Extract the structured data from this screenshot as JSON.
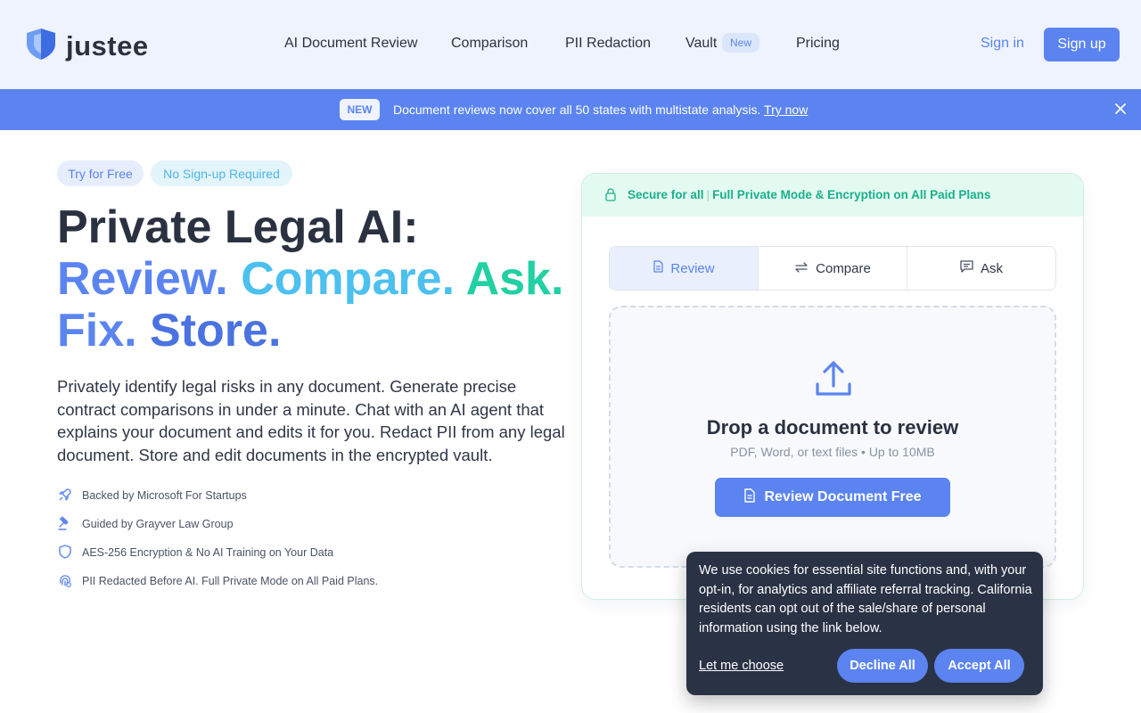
{
  "header": {
    "logo_text": "justee",
    "nav": [
      {
        "label": "AI Document Review"
      },
      {
        "label": "Comparison"
      },
      {
        "label": "PII Redaction"
      },
      {
        "label": "Vault",
        "badge": "New"
      },
      {
        "label": "Pricing"
      }
    ],
    "sign_in": "Sign in",
    "sign_up": "Sign up"
  },
  "banner": {
    "badge": "NEW",
    "text": "Document reviews now cover all 50 states with multistate analysis.",
    "link": "Try now",
    "close_icon": "close-icon"
  },
  "hero": {
    "chips": [
      "Try for Free",
      "No Sign-up Required"
    ],
    "headline_1": "Private Legal AI:",
    "headline_2": [
      "Review.",
      "Compare.",
      "Ask."
    ],
    "headline_3": [
      "Fix.",
      "Store."
    ],
    "description": "Privately identify legal risks in any document. Generate precise contract comparisons in under a minute. Chat with an AI agent that explains your document and edits it for you. Redact PII from any legal document. Store and edit documents in the encrypted vault.",
    "features": [
      {
        "icon": "rocket-icon",
        "text": "Backed by Microsoft For Startups"
      },
      {
        "icon": "gavel-icon",
        "text": "Guided by Grayver Law Group"
      },
      {
        "icon": "shield-icon",
        "text": "AES-256 Encryption & No AI Training on Your Data"
      },
      {
        "icon": "fingerprint-icon",
        "text": "PII Redacted Before AI. Full Private Mode on All Paid Plans."
      }
    ],
    "colors": {
      "blue": "#5b84f1",
      "sky": "#4cc0ef",
      "teal": "#21d0a3",
      "royal": "#4a72e0"
    }
  },
  "card": {
    "secure_label": "Secure for all",
    "secure_detail": "Full Private Mode & Encryption on All Paid Plans",
    "tabs": [
      {
        "label": "Review",
        "icon": "document-icon",
        "active": true
      },
      {
        "label": "Compare",
        "icon": "swap-icon",
        "active": false
      },
      {
        "label": "Ask",
        "icon": "chat-icon",
        "active": false
      }
    ],
    "drop_title": "Drop a document to review",
    "drop_sub": "PDF, Word, or text files • Up to 10MB",
    "drop_button": "Review Document Free"
  },
  "cookie": {
    "text": "We use cookies for essential site functions and, with your opt-in, for analytics and affiliate referral tracking. California residents can opt out of the sale/share of personal information using the link below.",
    "link": "Let me choose",
    "decline": "Decline All",
    "accept": "Accept All"
  }
}
